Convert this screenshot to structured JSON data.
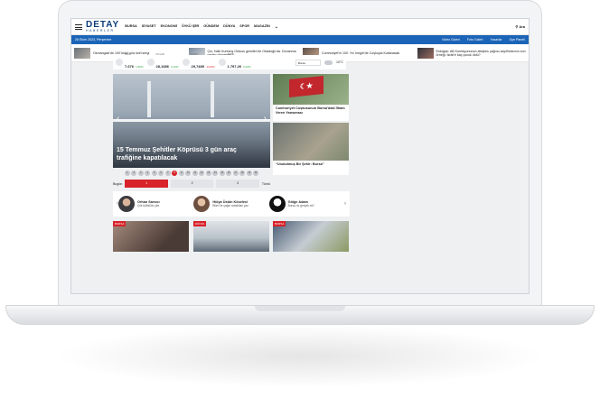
{
  "header": {
    "logo_main": "DETAY",
    "logo_accent": "",
    "logo_sub": "HABERLER",
    "nav": [
      "BURSA",
      "SİYASET",
      "EKONOMİ",
      "ÖYKÜ ŞİİR",
      "GÜNDEM",
      "DÜNYA",
      "SPOR",
      "MAGAZİN"
    ],
    "search_label": "Ara"
  },
  "bluebar": {
    "date": "26 Ekim 2023, Perşembe",
    "links": [
      "Video Galeri",
      "Foto Galeri",
      "Yazarlar",
      "Üye Paneli"
    ]
  },
  "breaking": [
    "Osmangazi’de 100’ünclü yıla özel sergi",
    "Çin, Halk Kurtuluş Ordusu gemileri ile Ortadoğu’da. Donanma neden gönderildi?",
    "Cumhuriyet’in 100. Yılı İnegöl’de Coşkuyla Kutlanacak",
    "Erdoğan: AB Komisyonunun ateşkes çağrısı zayıflıklarının son örneği. İsrail’e kaç çocuk öldü?"
  ],
  "market": [
    {
      "label": "BIST",
      "value": "7.676",
      "change": "1,96%",
      "neg": false
    },
    {
      "label": "DOLAR",
      "value": "28,1686",
      "change": "0,12%",
      "neg": false
    },
    {
      "label": "EURO",
      "value": "29,7489",
      "change": "-0,03%",
      "neg": true
    },
    {
      "label": "ALTIN",
      "value": "1.797,26",
      "change": "0,42%",
      "neg": false
    }
  ],
  "weather": {
    "city": "Bursa",
    "temp": "10°C"
  },
  "slider": {
    "caption": "15 Temmuz Şehitler Köprüsü 3 gün araç trafiğine kapatılacak",
    "pages": [
      "1",
      "2",
      "3",
      "4",
      "5",
      "6",
      "7",
      "8",
      "9",
      "10",
      "11",
      "12",
      "13",
      "14",
      "15",
      "16",
      "17",
      "18",
      "19",
      "20"
    ],
    "active_page": 8,
    "tab_left": "Bugün",
    "tab_right": "Tümü",
    "tabs": [
      "1",
      "2",
      "3"
    ]
  },
  "right_news": [
    {
      "title": "Cumhuriyet Coşkusunun Bursa’daki İlham Veren Yansıması"
    },
    {
      "title": "“Unutulmuş Bir Şehir: Bursa”"
    }
  ],
  "authors": [
    {
      "name": "Orhan Sarsıcı",
      "sub": "Çile bülbülün çile"
    },
    {
      "name": "Hülya Üstün Köseleci",
      "sub": "Bilen ile çağın anlattılan yaz"
    },
    {
      "name": "Gölge Adam",
      "sub": "Bursa mı gerçek mi?"
    }
  ],
  "cards": [
    {
      "tag": "BURSA"
    },
    {
      "tag": "DÜNYA"
    },
    {
      "tag": "BURSA"
    }
  ]
}
